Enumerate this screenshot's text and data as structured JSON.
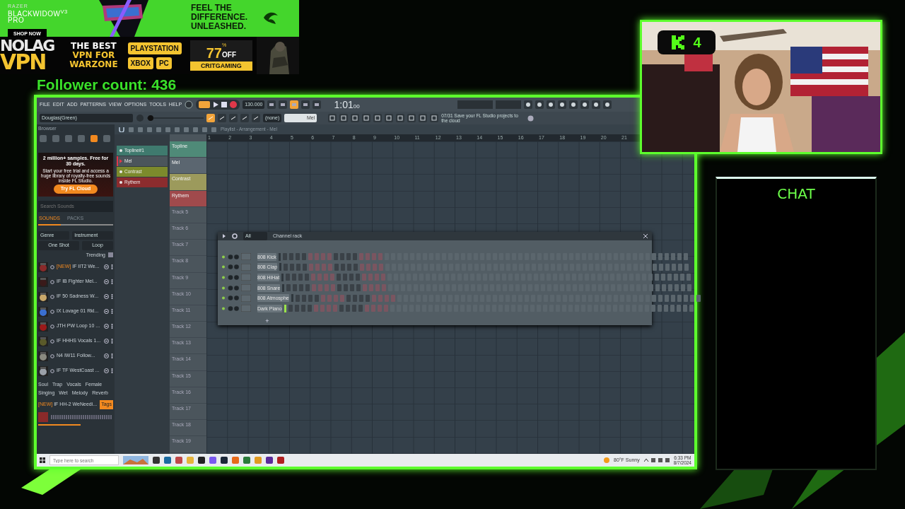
{
  "razer_ad": {
    "brand": "RAZER",
    "product": "BLACKWIDOW",
    "product_mark": "V3",
    "product_line2": "PRO",
    "button": "SHOP NOW",
    "tagline": [
      "FEEL THE",
      "DIFFERENCE.",
      "UNLEASHED."
    ]
  },
  "vpn_ad": {
    "logo_top": "NOLAG",
    "logo_bottom": "VPN",
    "headline": [
      "THE BEST",
      "VPN FOR",
      "WARZONE"
    ],
    "platforms": [
      "PLAYSTATION",
      "XBOX",
      "PC"
    ],
    "discount": "77",
    "discount_unit": "%",
    "discount_suffix": "OFF",
    "code": "CRITGAMING"
  },
  "follower_count": "Follower count: 436",
  "daw": {
    "menu": [
      "FILE",
      "EDIT",
      "ADD",
      "PATTERNS",
      "VIEW",
      "OPTIONS",
      "TOOLS",
      "HELP"
    ],
    "project": "Douglas(Green)",
    "master_pitch": {
      "level": 0.02
    },
    "tempo": "130.000",
    "time": "1:01",
    "time_small": "00",
    "pattern_selector": "(none)",
    "pattern_name": "Mel",
    "hint": [
      "07/31 Save your FL",
      "Studio projects to the cloud"
    ],
    "browser": {
      "title": "Browser",
      "promo": {
        "title": "2 million+ samples. Free for 30 days.",
        "body": "Start your free trial and access a huge library of royalty-free sounds inside FL Studio.",
        "button": "Try FL Cloud"
      },
      "search_placeholder": "Search Sounds",
      "tabs": [
        {
          "label": "SOUNDS",
          "selected": true
        },
        {
          "label": "PACKS",
          "selected": false
        }
      ],
      "filters": [
        "Genre",
        "Instrument"
      ],
      "types": [
        "One Shot",
        "Loop"
      ],
      "sort": "Trending",
      "items": [
        {
          "badge": "[NEW]",
          "label": "IF IIT2 We..."
        },
        {
          "label": "IF IB Fighter Mel..."
        },
        {
          "label": "IF 50 Sadness W..."
        },
        {
          "label": "IX Lovage 01 Rkl..."
        },
        {
          "label": "JTH PW Loop 10 ..."
        },
        {
          "label": "IF HHHS Vocals 1..."
        },
        {
          "label": "N4 IW11 Follow..."
        },
        {
          "label": "IF TF WestCoast ..."
        }
      ],
      "tags": [
        "Soul",
        "Trap",
        "Vocals",
        "Female",
        "Singing",
        "Wet",
        "Melody",
        "Reverb"
      ],
      "player": {
        "badge": "[NEW]",
        "label": "IF HH-2 WeNeedi...",
        "tags_button": "Tags"
      }
    },
    "patterns": [
      {
        "name": "Topline#1",
        "color": "#3f7a6e",
        "selected": false
      },
      {
        "name": "Mel",
        "color": "#4b555b",
        "selected": true
      },
      {
        "name": "Contrast",
        "color": "#7c8a2c",
        "selected": false
      },
      {
        "name": "Rythem",
        "color": "#8c2c2e",
        "selected": false
      }
    ],
    "playlist": {
      "title": "Playlist - Arrangement - Mel",
      "bars": [
        "1",
        "2",
        "3",
        "4",
        "5",
        "6",
        "7",
        "8",
        "9",
        "10",
        "11",
        "12",
        "13",
        "14",
        "15",
        "16",
        "17",
        "18",
        "19",
        "20",
        "21"
      ],
      "tracks": [
        {
          "name": "Topline",
          "color": "#4f8a78"
        },
        {
          "name": "Mel",
          "color": "#5b6670"
        },
        {
          "name": "Contrast",
          "color": "#9c9a5c"
        },
        {
          "name": "Rythem",
          "color": "#a04a4c"
        },
        {
          "name": "Track 5"
        },
        {
          "name": "Track 6"
        },
        {
          "name": "Track 7"
        },
        {
          "name": "Track 8"
        },
        {
          "name": "Track 9"
        },
        {
          "name": "Track 10"
        },
        {
          "name": "Track 11"
        },
        {
          "name": "Track 12"
        },
        {
          "name": "Track 13"
        },
        {
          "name": "Track 14"
        },
        {
          "name": "Track 15"
        },
        {
          "name": "Track 16"
        },
        {
          "name": "Track 17"
        },
        {
          "name": "Track 18"
        },
        {
          "name": "Track 19"
        }
      ]
    },
    "channel_rack": {
      "filter": "All",
      "title": "Channel rack",
      "add_label": "+",
      "channels": [
        {
          "name": "808 Kick",
          "selected": false
        },
        {
          "name": "808 Clap",
          "selected": false
        },
        {
          "name": "808 HiHat",
          "selected": false
        },
        {
          "name": "808 Snare",
          "selected": false
        },
        {
          "name": "808 Atmosphe",
          "selected": false
        },
        {
          "name": "Dark Piano",
          "selected": true
        }
      ]
    },
    "taskbar": {
      "search_placeholder": "Type here to search",
      "weather": "80°F Sunny",
      "time": "6:33 PM",
      "date": "8/7/2024"
    }
  },
  "webcam": {
    "viewers": "4"
  },
  "chat": {
    "title": "CHAT"
  }
}
